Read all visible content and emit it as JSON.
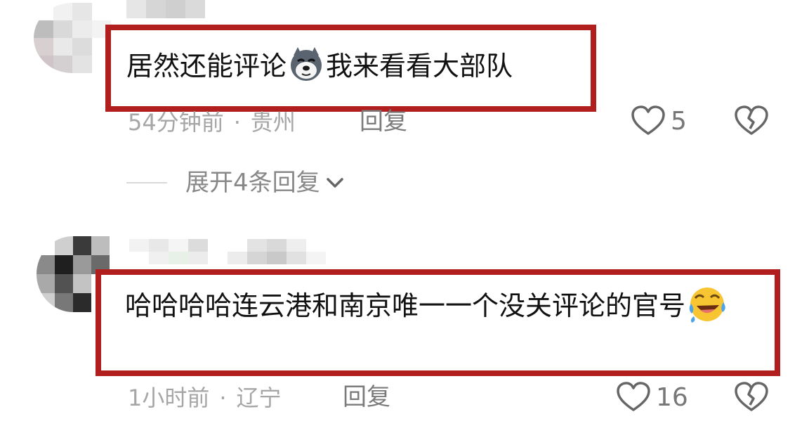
{
  "comments": [
    {
      "text_before_emoji": "居然还能评论",
      "emoji": "husky-dog-emoji",
      "text_after_emoji": "我来看看大部队",
      "time": "54分钟前",
      "location": "贵州",
      "separator": "·",
      "reply_label": "回复",
      "like_count": "5",
      "expand_replies_label": "展开4条回复"
    },
    {
      "text": "哈哈哈哈连云港和南京唯一一个没关评论的官号",
      "emoji": "laughing-tears-emoji",
      "time": "1小时前",
      "location": "辽宁",
      "separator": "·",
      "reply_label": "回复",
      "like_count": "16"
    }
  ],
  "icons": {
    "like": "heart-outline-icon",
    "dislike": "broken-heart-icon",
    "expand": "chevron-down-icon"
  },
  "colors": {
    "highlight_border": "#b01e1e",
    "meta_text": "#a6a6a6",
    "icon_stroke": "#666666"
  }
}
